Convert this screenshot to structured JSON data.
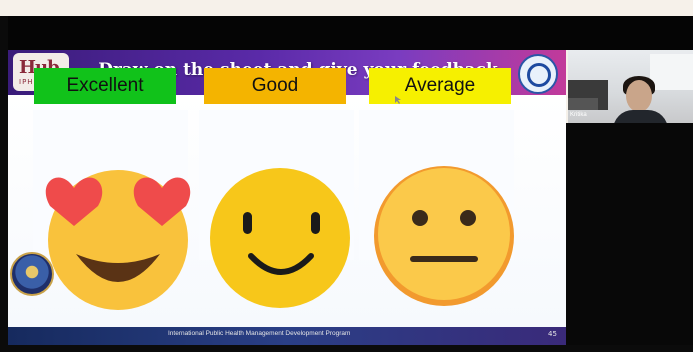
{
  "slide": {
    "title": "Draw on the sheet and give your feedback",
    "logo_text": "Hub",
    "logo_subtext": "IPHMDP",
    "labels": {
      "excellent": "Excellent",
      "good": "Good",
      "average": "Average"
    },
    "footer_text": "International Public Health Management Development Program",
    "page_number": "45"
  },
  "webcam": {
    "participant_name": "Kritika"
  },
  "icons": {
    "excellent": "heart-eyes-emoji-icon",
    "good": "smiley-face-emoji-icon",
    "average": "neutral-face-emoji-icon"
  },
  "colors": {
    "excellent_label": "#11c21a",
    "good_label": "#f4b400",
    "average_label": "#f6f000",
    "header_gradient_start": "#3a1c7a",
    "header_gradient_end": "#c23a9a"
  }
}
